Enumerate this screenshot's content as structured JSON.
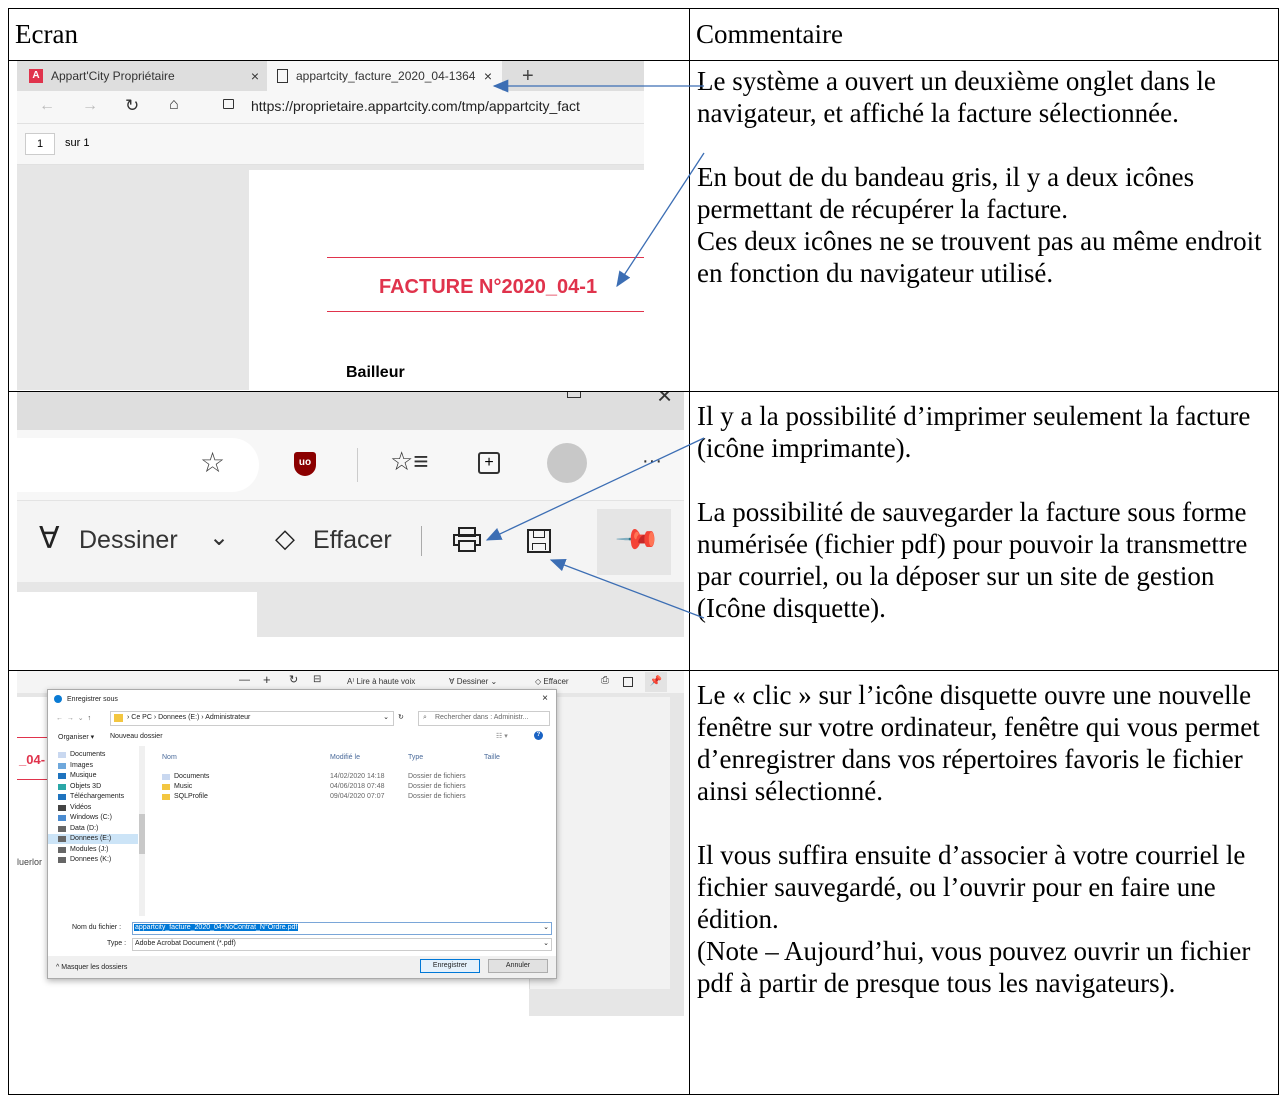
{
  "table": {
    "header": {
      "col1": "Ecran",
      "col2": "Commentaire"
    }
  },
  "row1": {
    "browser": {
      "tab1_label": "Appart'City Propriétaire",
      "tab2_label": "appartcity_facture_2020_04-1364",
      "url": "https://proprietaire.appartcity.com/tmp/appartcity_fact",
      "page_number": "1",
      "page_of": "sur 1",
      "facture_title": "FACTURE N°2020_04-1",
      "bailleur": "Bailleur"
    },
    "comment": [
      "Le système a ouvert un deuxième onglet dans le navigateur, et affiché la facture sélectionnée.",
      "En bout de du bandeau gris, il y a deux icônes permettant de récupérer la facture.",
      "Ces deux icônes ne se trouvent pas au même endroit en fonction du navigateur utilisé."
    ]
  },
  "row2": {
    "toolbar": {
      "draw_label": "Dessiner",
      "erase_label": "Effacer",
      "more_label": "···"
    },
    "comment": [
      "Il y a la possibilité d’imprimer seulement la facture (icône imprimante).",
      "La possibilité de sauvegarder la facture sous forme numérisée (fichier pdf) pour pouvoir la transmettre par courriel, ou la déposer sur un site de gestion (Icône disquette)."
    ]
  },
  "row3": {
    "toolbar": {
      "read_aloud": "A⁾ Lire à haute voix",
      "draw": "Dessiner",
      "erase": "Effacer"
    },
    "side_fragment": "_04-",
    "side_fragment2": "luerlor",
    "dialog": {
      "title": "Enregistrer sous",
      "breadcrumb": "›  Ce PC  ›  Donnees (E:)  ›  Administrateur",
      "search_placeholder": "Rechercher dans : Administr...",
      "organize": "Organiser ▾",
      "new_folder": "Nouveau dossier",
      "nav_items": [
        "Documents",
        "Images",
        "Musique",
        "Objets 3D",
        "Téléchargements",
        "Vidéos",
        "Windows (C:)",
        "Data (D:)",
        "Donnees (E:)",
        "Modules (J:)",
        "Donnees (K:)"
      ],
      "columns": [
        "Nom",
        "Modifié le",
        "Type",
        "Taille"
      ],
      "files": [
        {
          "name": "Documents",
          "date": "14/02/2020 14:18",
          "type": "Dossier de fichiers"
        },
        {
          "name": "Music",
          "date": "04/06/2018 07:48",
          "type": "Dossier de fichiers"
        },
        {
          "name": "SQLProfile",
          "date": "09/04/2020 07:07",
          "type": "Dossier de fichiers"
        }
      ],
      "filename_label": "Nom du fichier :",
      "filename_value": "appartcity_facture_2020_04-NoContrat_N°Ordre.pdf",
      "type_label": "Type :",
      "type_value": "Adobe Acrobat Document (*.pdf)",
      "hide_folders": "Masquer les dossiers",
      "save_button": "Enregistrer",
      "cancel_button": "Annuler"
    },
    "comment": [
      "Le « clic » sur l’icône disquette ouvre une nouvelle fenêtre sur votre ordinateur, fenêtre qui vous permet d’enregistrer dans vos répertoires favoris le fichier ainsi sélectionné.",
      "Il vous suffira ensuite d’associer à votre courriel le fichier sauvegardé, ou l’ouvrir pour en faire une édition.",
      "(Note – Aujourd’hui, vous pouvez ouvrir un fichier pdf à partir de presque tous les navigateurs)."
    ]
  },
  "colors": {
    "facture_red": "#e0334c",
    "arrow_blue": "#3c6eb4",
    "selection_blue": "#0078d7"
  }
}
